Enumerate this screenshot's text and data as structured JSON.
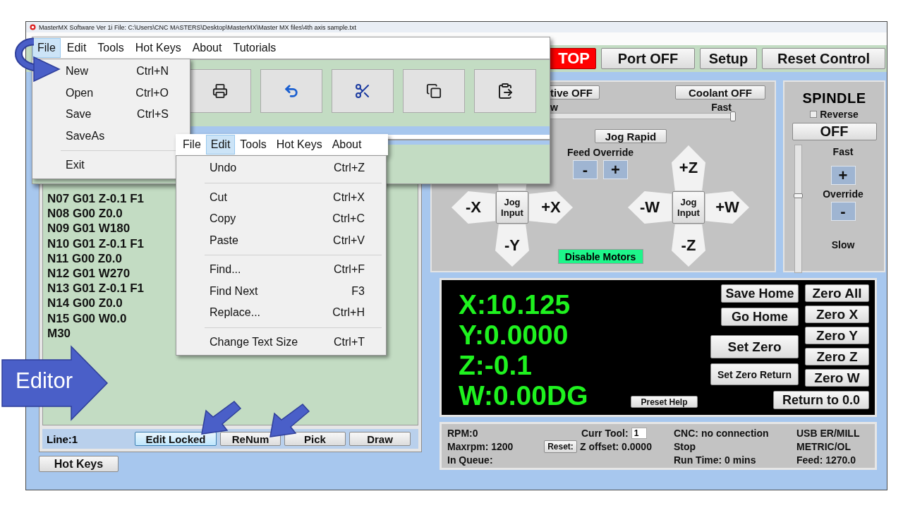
{
  "window": {
    "title": "MasterMX Software Ver 1i File: C:\\Users\\CNC MASTERS\\Desktop\\MasterMX\\Master MX files\\4th axis sample.txt"
  },
  "top_buttons": [
    {
      "kind": "stop",
      "label": "TOP"
    },
    {
      "kind": "normal",
      "label": "Port OFF"
    },
    {
      "kind": "normal",
      "label": "Setup"
    },
    {
      "kind": "normal",
      "label": "Reset Control"
    }
  ],
  "editor": {
    "lines": [
      "N07 G01 Z-0.1 F1",
      "N08 G00 Z0.0",
      "N09 G01 W180",
      "N10 G01 Z-0.1 F1",
      "N11 G00 Z0.0",
      "N12 G01 W270",
      "N13 G01 Z-0.1 F1",
      "N14 G00 Z0.0",
      "N15 G00 W0.0",
      "M30"
    ],
    "line_label": "Line:1",
    "buttons": [
      {
        "label": "Edit Locked",
        "selected": true
      },
      {
        "label": "ReNum",
        "selected": false
      },
      {
        "label": "Pick",
        "selected": false
      },
      {
        "label": "Draw",
        "selected": false
      }
    ]
  },
  "hot_keys_button": "Hot Keys",
  "jog": {
    "active_button": "tive OFF",
    "coolant_button": "Coolant OFF",
    "speed_slider": {
      "min_label": "w",
      "max_label": "Fast",
      "level": 1.0
    },
    "jog_rapid_button": "Jog Rapid",
    "feed_override": {
      "label": "Feed Override",
      "minus": "-",
      "plus": "+"
    },
    "xy_pad": {
      "left": "-X",
      "center": "Jog Input",
      "right": "+X",
      "bottom": "-Y"
    },
    "zw_pad": {
      "top": "+Z",
      "left": "-W",
      "center": "Jog Input",
      "right": "+W",
      "bottom": "-Z"
    },
    "disable_motors_button": "Disable Motors"
  },
  "spindle": {
    "title": "SPINDLE",
    "reverse": {
      "label": "Reverse",
      "checked": false
    },
    "state_button": "OFF",
    "fast_label": "Fast",
    "plus": "+",
    "override_label": "Override",
    "minus": "-",
    "slow_label": "Slow",
    "override_slider": {
      "level": 0.6
    }
  },
  "dro": {
    "readouts": [
      "X:10.125",
      "Y:0.0000",
      "Z:-0.1",
      "W:0.00DG"
    ],
    "home_buttons": [
      "Save Home",
      "Go Home",
      "Set Zero",
      "Set Zero Return"
    ],
    "zero_buttons": [
      "Zero All",
      "Zero X",
      "Zero Y",
      "Zero Z",
      "Zero W"
    ],
    "return_button": "Return to 0.0",
    "preset_help_button": "Preset Help"
  },
  "status": {
    "rpm": "RPM:0",
    "maxrpm": "Maxrpm: 1200",
    "in_queue": "In Queue:",
    "curr_tool_label": "Curr Tool:",
    "curr_tool_value": "1",
    "reset_button": "Reset:",
    "z_offset": "Z offset: 0.0000",
    "cnc": "CNC: no connection",
    "state": "Stop",
    "run_time": "Run Time: 0 mins",
    "device": "USB ER/MILL",
    "units": "METRIC/OL",
    "feed": "Feed: 1270.0"
  },
  "file_overlay": {
    "menu": [
      {
        "label": "File",
        "selected": true
      },
      {
        "label": "Edit",
        "selected": false
      },
      {
        "label": "Tools",
        "selected": false
      },
      {
        "label": "Hot Keys",
        "selected": false
      },
      {
        "label": "About",
        "selected": false
      },
      {
        "label": "Tutorials",
        "selected": false
      }
    ],
    "dropdown": [
      {
        "kind": "item",
        "label": "New",
        "shortcut": "Ctrl+N"
      },
      {
        "kind": "item",
        "label": "Open",
        "shortcut": "Ctrl+O"
      },
      {
        "kind": "item",
        "label": "Save",
        "shortcut": "Ctrl+S"
      },
      {
        "kind": "item",
        "label": "SaveAs"
      },
      {
        "kind": "separator"
      },
      {
        "kind": "item",
        "label": "Exit"
      }
    ]
  },
  "edit_overlay": {
    "menu": [
      {
        "label": "File",
        "selected": false
      },
      {
        "label": "Edit",
        "selected": true
      },
      {
        "label": "Tools",
        "selected": false
      },
      {
        "label": "Hot Keys",
        "selected": false
      },
      {
        "label": "About",
        "selected": false
      }
    ],
    "dropdown": [
      {
        "kind": "item",
        "label": "Undo",
        "shortcut": "Ctrl+Z"
      },
      {
        "kind": "separator"
      },
      {
        "kind": "item",
        "label": "Cut",
        "shortcut": "Ctrl+X"
      },
      {
        "kind": "item",
        "label": "Copy",
        "shortcut": "Ctrl+C"
      },
      {
        "kind": "item",
        "label": "Paste",
        "shortcut": "Ctrl+V"
      },
      {
        "kind": "separator"
      },
      {
        "kind": "item",
        "label": "Find...",
        "shortcut": "Ctrl+F"
      },
      {
        "kind": "item",
        "label": "Find Next",
        "shortcut": "F3"
      },
      {
        "kind": "item",
        "label": "Replace...",
        "shortcut": "Ctrl+H"
      },
      {
        "kind": "separator"
      },
      {
        "kind": "item",
        "label": "Change Text Size",
        "shortcut": "Ctrl+T"
      }
    ]
  },
  "callout": {
    "label": "Editor"
  }
}
